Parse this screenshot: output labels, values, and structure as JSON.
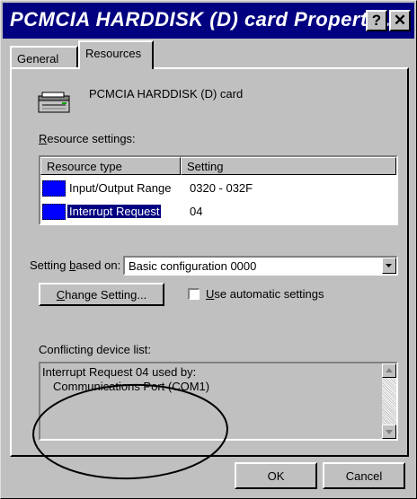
{
  "window": {
    "title": "PCMCIA HARDDISK (D) card Properti...",
    "help_label": "?",
    "close_label": "✕"
  },
  "tabs": [
    {
      "label": "General",
      "active": false
    },
    {
      "label": "Resources",
      "active": true
    }
  ],
  "device": {
    "icon": "pcmcia-card-icon",
    "name": "PCMCIA HARDDISK (D) card"
  },
  "resource_settings": {
    "label_accel": "R",
    "label_rest": "esource settings:",
    "columns": [
      "Resource type",
      "Setting"
    ],
    "rows": [
      {
        "type": "Input/Output Range",
        "setting": "0320 - 032F",
        "selected": false
      },
      {
        "type": "Interrupt Request",
        "setting": "04",
        "selected": true
      }
    ]
  },
  "setting_based_on": {
    "label_pre": "Setting ",
    "label_accel": "b",
    "label_post": "ased on:",
    "value": "Basic configuration 0000"
  },
  "change_setting": {
    "accel": "C",
    "rest": "hange Setting..."
  },
  "auto_settings": {
    "accel": "U",
    "rest": "se automatic settings",
    "checked": false
  },
  "conflict": {
    "label": "Conflicting device list:",
    "lines": [
      "Interrupt Request 04 used by:",
      "Communications Port (COM1)"
    ]
  },
  "buttons": {
    "ok": "OK",
    "cancel": "Cancel"
  },
  "colors": {
    "titlebar": "#000080",
    "face": "#c0c0c0",
    "selection": "#000080",
    "resource_icon": "#0000ff"
  }
}
